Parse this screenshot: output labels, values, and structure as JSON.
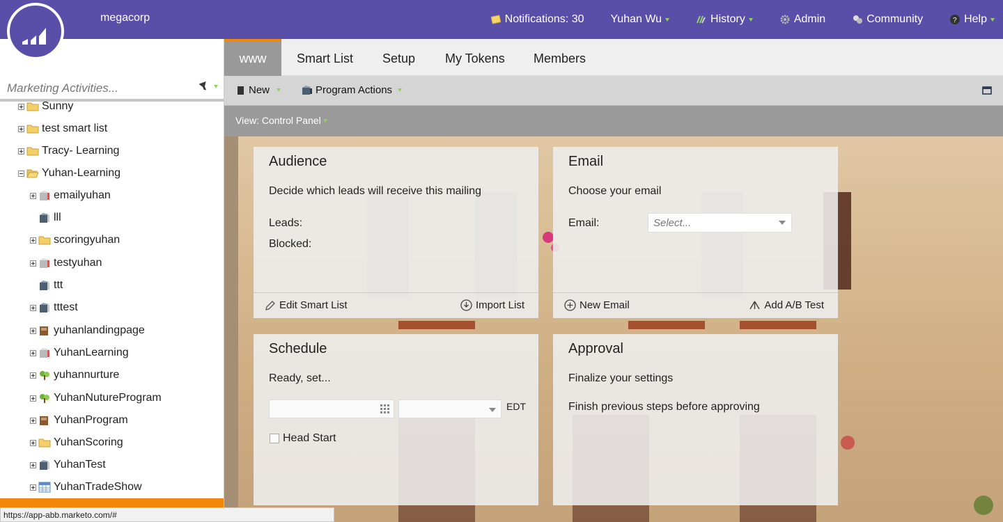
{
  "brand": "megacorp",
  "topnav": {
    "notifications": "Notifications: 30",
    "user": "Yuhan Wu",
    "history": "History",
    "admin": "Admin",
    "community": "Community",
    "help": "Help"
  },
  "left": {
    "search_placeholder": "Marketing Activities...",
    "tree": [
      {
        "label": "Sunny",
        "expanded": false,
        "icon": "folder-icon"
      },
      {
        "label": "test smart list",
        "expanded": false,
        "icon": "folder-icon"
      },
      {
        "label": "Tracy- Learning",
        "expanded": false,
        "icon": "folder-icon"
      },
      {
        "label": "Yuhan-Learning",
        "expanded": true,
        "icon": "folder-open-icon"
      },
      {
        "label": "emailyuhan",
        "expanded": false,
        "icon": "program-icon"
      },
      {
        "label": "lll",
        "expanded": null,
        "icon": "email-program-icon"
      },
      {
        "label": "scoringyuhan",
        "expanded": false,
        "icon": "folder-icon"
      },
      {
        "label": "testyuhan",
        "expanded": false,
        "icon": "program-icon"
      },
      {
        "label": "ttt",
        "expanded": null,
        "icon": "email-program-icon"
      },
      {
        "label": "tttest",
        "expanded": false,
        "icon": "email-program-icon"
      },
      {
        "label": "yuhanlandingpage",
        "expanded": false,
        "icon": "landing-page-icon"
      },
      {
        "label": "YuhanLearning",
        "expanded": false,
        "icon": "program-icon"
      },
      {
        "label": "yuhannurture",
        "expanded": false,
        "icon": "nurture-icon"
      },
      {
        "label": "YuhanNutureProgram",
        "expanded": false,
        "icon": "nurture-icon"
      },
      {
        "label": "YuhanProgram",
        "expanded": false,
        "icon": "landing-page-icon"
      },
      {
        "label": "YuhanScoring",
        "expanded": false,
        "icon": "folder-icon"
      },
      {
        "label": "YuhanTest",
        "expanded": false,
        "icon": "email-program-icon"
      },
      {
        "label": "YuhanTradeShow",
        "expanded": false,
        "icon": "event-icon"
      }
    ],
    "status_url": "https://app-abb.marketo.com/#"
  },
  "tabs": [
    {
      "label": "www",
      "active": true
    },
    {
      "label": "Smart List",
      "active": false
    },
    {
      "label": "Setup",
      "active": false
    },
    {
      "label": "My Tokens",
      "active": false
    },
    {
      "label": "Members",
      "active": false
    }
  ],
  "toolbar": {
    "new_label": "New",
    "program_actions_label": "Program Actions",
    "view_label": "View: Control Panel"
  },
  "cards": {
    "audience": {
      "title": "Audience",
      "desc": "Decide which leads will receive this mailing",
      "leads_label": "Leads:",
      "blocked_label": "Blocked:",
      "edit_smart_list": "Edit Smart List",
      "import_list": "Import List"
    },
    "email": {
      "title": "Email",
      "desc": "Choose your email",
      "email_label": "Email:",
      "select_placeholder": "Select...",
      "new_email": "New Email",
      "add_ab_test": "Add A/B Test"
    },
    "schedule": {
      "title": "Schedule",
      "desc": "Ready, set...",
      "timezone": "EDT",
      "head_start": "Head Start"
    },
    "approval": {
      "title": "Approval",
      "desc": "Finalize your settings",
      "note": "Finish previous steps before approving"
    }
  },
  "colors": {
    "topbar": "#5a4fa8",
    "accent": "#f0860a",
    "caret": "#8fd35f"
  }
}
